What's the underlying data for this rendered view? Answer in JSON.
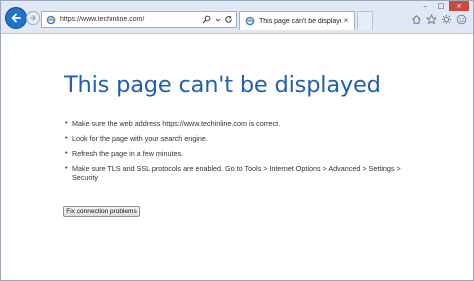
{
  "browser": {
    "address_url": "https://www.techinline.com/",
    "tab_title": "This page can't be displayed",
    "tab_close": "×",
    "back_icon": "back-arrow-icon",
    "forward_icon": "forward-arrow-icon",
    "accent_color": "#1e74c8"
  },
  "window_controls": {
    "minimize": "–",
    "maximize": "□",
    "close": "×"
  },
  "page": {
    "heading": "This page can't be displayed",
    "heading_color": "#1f5fb5",
    "items": [
      "Make sure the web address https://www.techinline.com is correct.",
      "Look for the page with your search engine.",
      "Refresh the page in a few minutes.",
      "Make sure TLS and SSL protocols are enabled. Go to Tools > Internet Options > Advanced > Settings > Security"
    ],
    "bullet": "•",
    "fix_button_label": "Fix connection problems"
  }
}
